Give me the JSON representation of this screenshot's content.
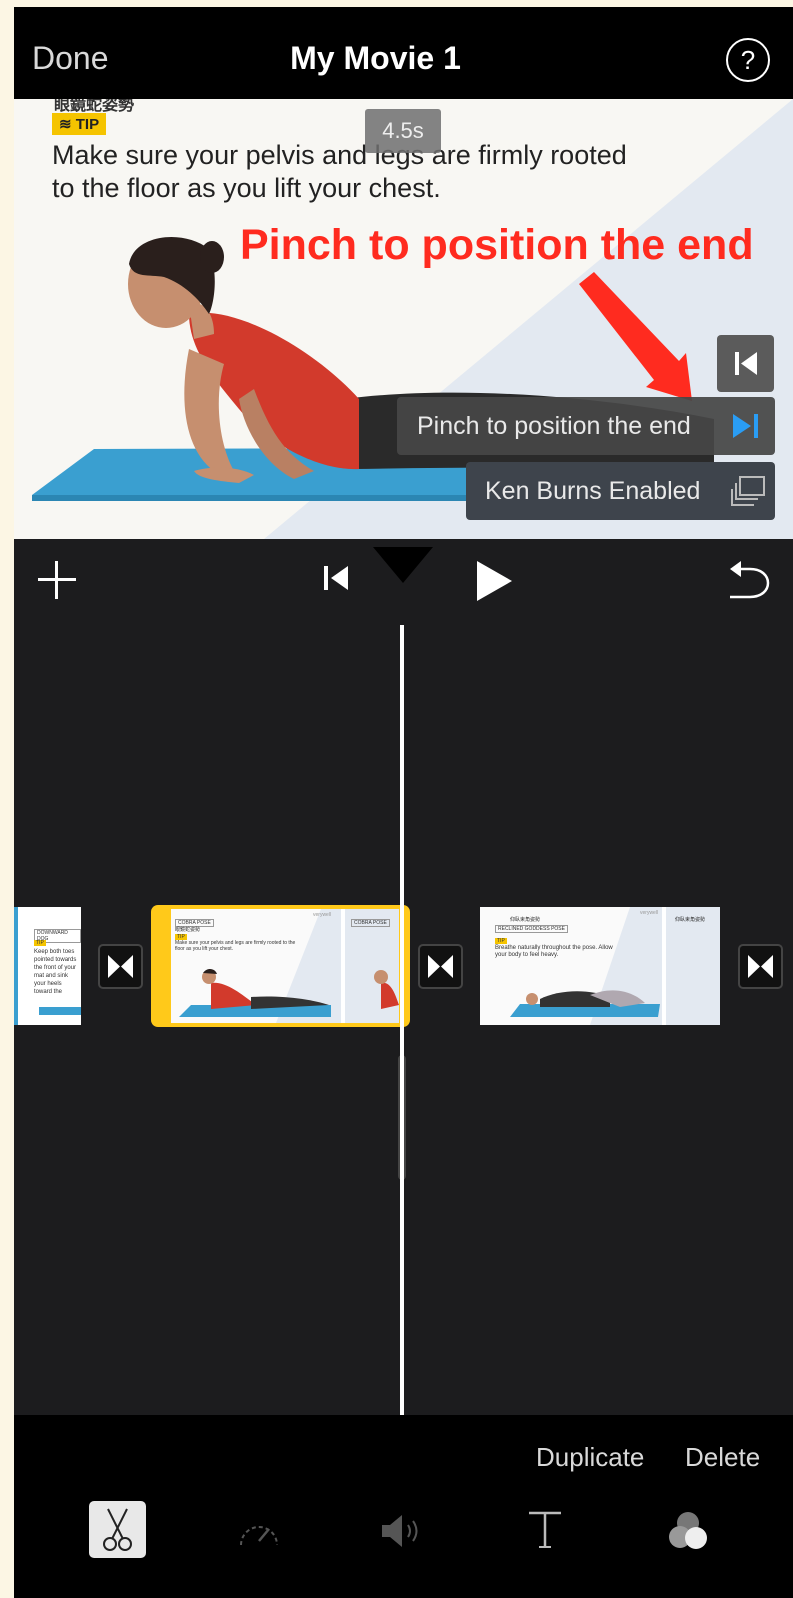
{
  "nav": {
    "done": "Done",
    "title": "My Movie 1",
    "help": "?"
  },
  "viewer": {
    "cut_text": "眼鏡蛇姿勢",
    "tip_badge": "TIP",
    "duration": "4.5s",
    "slide_text": "Make sure your pelvis and legs are firmly rooted to the floor as you lift your chest.",
    "annotation": "Pinch to position the end",
    "pinch_button": "Pinch to position the end",
    "ken_burns": "Ken Burns Enabled"
  },
  "clips": {
    "clip1": {
      "title": "DOWNWARD DOG",
      "tip": "TIP",
      "text": "Keep both toes pointed towards the front of your mat and sink your heels toward the"
    },
    "clip2": {
      "title": "COBRA POSE",
      "subtitle": "眼鏡蛇姿勢",
      "tip": "TIP",
      "text": "Make sure your pelvis and legs are firmly rooted to the floor as you lift your chest.",
      "brand": "verywell"
    },
    "clip3": {
      "title": "RECLINED GODDESS POSE",
      "subtitle": "仰臥束角姿勢",
      "tip": "TIP",
      "text": "Breathe naturally throughout the pose. Allow your body to feel heavy.",
      "brand": "verywell"
    }
  },
  "bottom": {
    "duplicate": "Duplicate",
    "delete": "Delete"
  },
  "colors": {
    "accent_yellow": "#f5c400",
    "annotation_red": "#ff2b1f",
    "ken_burns_blue": "#2a9df4"
  },
  "icons": [
    "plus-icon",
    "skip-to-start-icon",
    "play-icon",
    "undo-icon",
    "scissors-icon",
    "speed-icon",
    "volume-icon",
    "text-icon",
    "filters-icon"
  ]
}
